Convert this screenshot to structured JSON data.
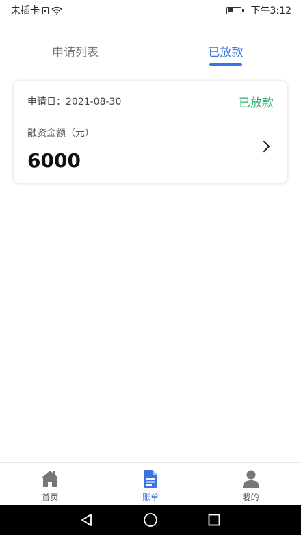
{
  "status_bar": {
    "carrier": "未插卡",
    "time": "下午3:12"
  },
  "tabs": [
    {
      "label": "申请列表",
      "active": false
    },
    {
      "label": "已放款",
      "active": true
    }
  ],
  "card": {
    "date_text": "申请日：2021-08-30",
    "status": "已放款",
    "amount_label": "融资金额（元）",
    "amount": "6000"
  },
  "bottom_nav": [
    {
      "label": "首页",
      "icon": "home-icon",
      "active": false
    },
    {
      "label": "账单",
      "icon": "document-icon",
      "active": true
    },
    {
      "label": "我的",
      "icon": "person-icon",
      "active": false
    }
  ],
  "colors": {
    "accent": "#3b73e6",
    "status_green": "#2fb26a",
    "inactive_icon": "#777777"
  }
}
